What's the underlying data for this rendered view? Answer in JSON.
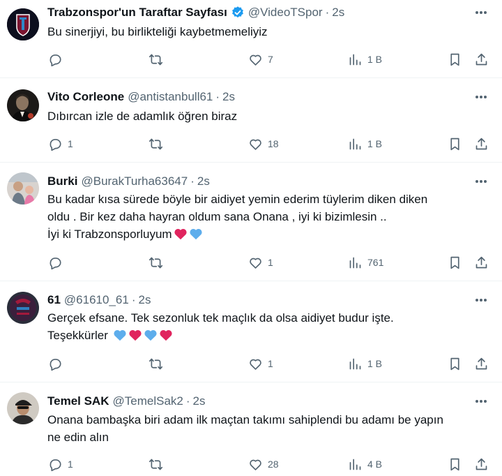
{
  "tweets": [
    {
      "name": "Trabzonspor'un Taraftar Sayfası",
      "verified": true,
      "handle": "@VideoTSpor",
      "time": "2s",
      "lines": [
        "Bu sinerjiyi, bu birlikteliği kaybetmemeliyiz"
      ],
      "emojis": [],
      "replies": "",
      "reposts": "",
      "likes": "7",
      "views": "1 B",
      "avatar": "trabzonspor-logo"
    },
    {
      "name": "Vito Corleone",
      "verified": false,
      "handle": "@antistanbull61",
      "time": "2s",
      "lines": [
        "Dıbırcan izle de adamlık öğren biraz"
      ],
      "emojis": [],
      "replies": "1",
      "reposts": "",
      "likes": "18",
      "views": "1 B",
      "avatar": "godfather-photo"
    },
    {
      "name": "Burki",
      "verified": false,
      "handle": "@BurakTurha63647",
      "time": "2s",
      "lines": [
        "Bu kadar kısa sürede böyle bir aidiyet yemin ederim tüylerim diken diken",
        "oldu . Bir kez daha hayran oldum sana Onana , iyi ki bizimlesin ..",
        "İyi ki Trabzonsporluyum"
      ],
      "emojis": [
        "red-heart",
        "blue-heart"
      ],
      "replies": "",
      "reposts": "",
      "likes": "1",
      "views": "761",
      "avatar": "family-photo"
    },
    {
      "name": "61",
      "verified": false,
      "handle": "@61610_61",
      "time": "2s",
      "lines": [
        "Gerçek efsane. Tek sezonluk tek maçlık da olsa aidiyet budur işte.",
        "Teşekkürler"
      ],
      "emojis": [
        "blue-heart",
        "red-heart",
        "blue-heart",
        "red-heart"
      ],
      "replies": "",
      "reposts": "",
      "likes": "1",
      "views": "1 B",
      "avatar": "number-61-logo"
    },
    {
      "name": "Temel SAK",
      "verified": false,
      "handle": "@TemelSak2",
      "time": "2s",
      "lines": [
        "Onana bambaşka biri adam ilk maçtan takımı sahiplendi bu adamı be yapın",
        "ne edin alın"
      ],
      "emojis": [],
      "replies": "1",
      "reposts": "",
      "likes": "28",
      "views": "4 B",
      "avatar": "man-in-cap-photo"
    }
  ],
  "colors": {
    "text": "#0f1419",
    "muted": "#536471",
    "divider": "#eff3f4",
    "verified": "#1d9bf0",
    "red_heart": "#e0245e",
    "blue_heart": "#5dadec"
  },
  "icons": {
    "reply": "speech-bubble-icon",
    "repost": "repost-arrows-icon",
    "like": "heart-icon",
    "views": "bar-chart-icon",
    "bookmark": "bookmark-icon",
    "share": "share-upload-icon",
    "more": "ellipsis-icon",
    "verified": "verified-badge-icon"
  }
}
